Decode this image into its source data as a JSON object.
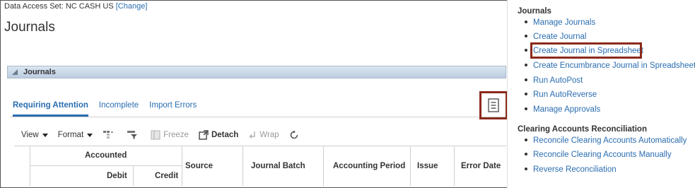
{
  "header": {
    "data_access_label": "Data Access Set:",
    "data_access_value": "NC CASH US",
    "change_link": "[Change]",
    "page_title": "Journals"
  },
  "panel": {
    "title": "Journals"
  },
  "tabs": [
    {
      "label": "Requiring Attention",
      "active": true
    },
    {
      "label": "Incomplete",
      "active": false
    },
    {
      "label": "Import Errors",
      "active": false
    }
  ],
  "toolbar": {
    "view": "View",
    "format": "Format",
    "freeze": "Freeze",
    "detach": "Detach",
    "wrap": "Wrap"
  },
  "table": {
    "group_header": "Accounted",
    "columns": {
      "debit": "Debit",
      "credit": "Credit",
      "source": "Source",
      "journal_batch": "Journal Batch",
      "accounting_period": "Accounting Period",
      "issue": "Issue",
      "error_date": "Error Date"
    }
  },
  "tasks_menu": {
    "journals_heading": "Journals",
    "journals_items": [
      "Manage Journals",
      "Create Journal",
      "Create Journal in Spreadsheet",
      "Create Encumbrance Journal in Spreadsheet",
      "Run AutoPost",
      "Run AutoReverse",
      "Manage Approvals"
    ],
    "clearing_heading": "Clearing Accounts Reconciliation",
    "clearing_items": [
      "Reconcile Clearing Accounts Automatically",
      "Reconcile Clearing Accounts Manually",
      "Reverse Reconciliation"
    ]
  },
  "colors": {
    "link": "#2a6db0",
    "highlight_border": "#8b2a1c",
    "panel_header": "#c9d7e8"
  }
}
